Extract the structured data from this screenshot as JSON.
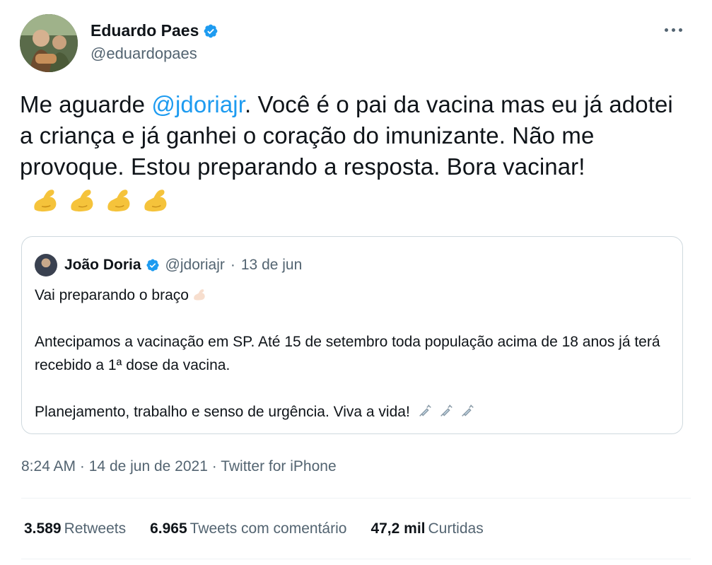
{
  "author": {
    "display_name": "Eduardo Paes",
    "handle": "@eduardopaes",
    "verified": true
  },
  "tweet": {
    "text_before_mention": "Me aguarde ",
    "mention": "@jdoriajr",
    "text_after_mention": ".  Você é o pai da vacina mas eu já adotei a criança e já ganhei o coração do imunizante. Não me provoque.  Estou preparando a resposta.  Bora vacinar!",
    "emojis": [
      "flexed-biceps",
      "flexed-biceps",
      "flexed-biceps",
      "flexed-biceps"
    ]
  },
  "quoted": {
    "display_name": "João Doria",
    "handle": "@jdoriajr",
    "separator": "·",
    "date": "13 de jun",
    "line1": "Vai preparando o braço",
    "line2": "Antecipamos a vacinação em SP. Até 15 de setembro toda população acima de 18 anos já terá recebido a 1ª dose da vacina.",
    "line3": "Planejamento, trabalho e senso de urgência. Viva a vida!"
  },
  "meta": {
    "time": "8:24 AM",
    "sep1": "·",
    "date": "14 de jun de 2021",
    "sep2": "·",
    "source": "Twitter for iPhone"
  },
  "stats": {
    "retweets_count": "3.589",
    "retweets_label": "Retweets",
    "quotes_count": "6.965",
    "quotes_label": "Tweets com comentário",
    "likes_count": "47,2 mil",
    "likes_label": "Curtidas"
  },
  "colors": {
    "link": "#1d9bf0",
    "secondary_text": "#536471",
    "border": "#cfd9de",
    "verified": "#1d9bf0"
  }
}
